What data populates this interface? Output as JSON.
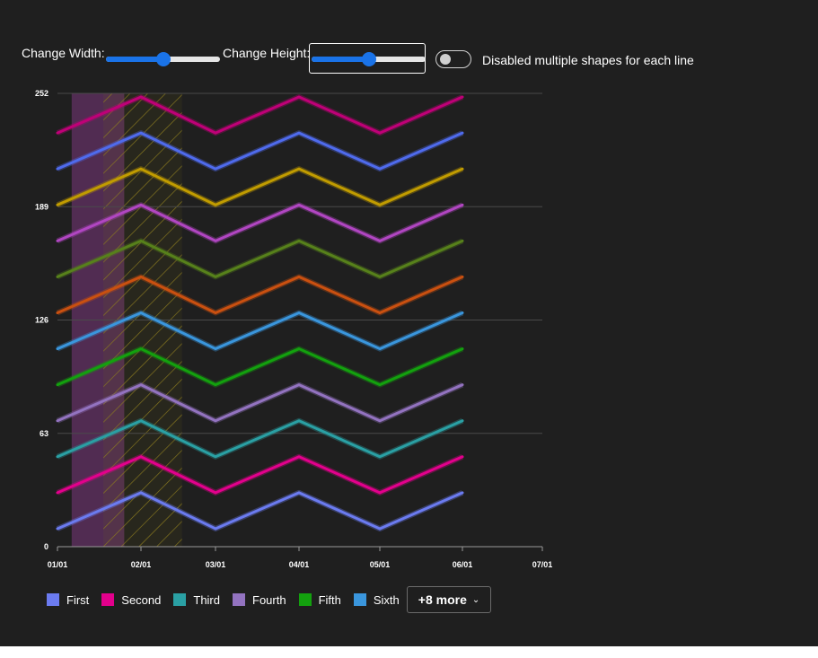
{
  "controls": {
    "width_label": "Change Width:",
    "height_label": "Change Height:",
    "width_slider_value": 0.5,
    "height_slider_value": 0.5,
    "toggle_label": "Disabled multiple shapes for each line",
    "toggle_on": false
  },
  "colors": {
    "background": "#1f1f1f",
    "slider": "#1a73e8",
    "hatch": "#8a7a1e",
    "band": "#5a2f5c"
  },
  "legend": {
    "more_label": "+8 more",
    "chevron_icon": "chevron-down-icon"
  },
  "chart_data": {
    "type": "line",
    "x": [
      "01/01",
      "02/01",
      "03/01",
      "04/01",
      "05/01",
      "06/01"
    ],
    "x_ticks": [
      "01/01",
      "02/01",
      "03/01",
      "04/01",
      "05/01",
      "06/01",
      "07/01"
    ],
    "y_ticks": [
      "0",
      "63",
      "126",
      "189",
      "252"
    ],
    "ylim": [
      0,
      252
    ],
    "grid": true,
    "legend_position": "bottom-left",
    "series": [
      {
        "name": "First",
        "color": "#6b7bf0",
        "values": [
          10,
          30,
          10,
          30,
          10,
          30
        ]
      },
      {
        "name": "Second",
        "color": "#e3008c",
        "values": [
          30,
          50,
          30,
          50,
          30,
          50
        ]
      },
      {
        "name": "Third",
        "color": "#2aa0a4",
        "values": [
          50,
          70,
          50,
          70,
          50,
          70
        ]
      },
      {
        "name": "Fourth",
        "color": "#9373c0",
        "values": [
          70,
          90,
          70,
          90,
          70,
          90
        ]
      },
      {
        "name": "Fifth",
        "color": "#13a10e",
        "values": [
          90,
          110,
          90,
          110,
          90,
          110
        ]
      },
      {
        "name": "Sixth",
        "color": "#3a96dd",
        "values": [
          110,
          130,
          110,
          130,
          110,
          130
        ]
      },
      {
        "color": "#ca5010",
        "values": [
          130,
          150,
          130,
          150,
          130,
          150
        ]
      },
      {
        "color": "#57811b",
        "values": [
          150,
          170,
          150,
          170,
          150,
          170
        ]
      },
      {
        "color": "#b146c2",
        "values": [
          170,
          190,
          170,
          190,
          170,
          190
        ]
      },
      {
        "color": "#c19c00",
        "values": [
          190,
          210,
          190,
          210,
          190,
          210
        ]
      },
      {
        "color": "#4f6bed",
        "values": [
          210,
          230,
          210,
          230,
          210,
          230
        ]
      },
      {
        "color": "#bf0077",
        "values": [
          230,
          250,
          230,
          250,
          230,
          250
        ]
      }
    ],
    "regions": [
      {
        "kind": "band",
        "from": "01/01",
        "to": "02/01",
        "start_fraction": 0.17,
        "end_fraction": 0.8
      },
      {
        "kind": "hatch",
        "from": "01/01",
        "to": "03/01",
        "start_fraction": 0.55,
        "end_fraction": 0.55
      },
      {
        "kind": "hatch",
        "from": "04/01",
        "to": "05/01",
        "start_fraction": 0.5,
        "end_fraction": 0.28
      }
    ]
  }
}
